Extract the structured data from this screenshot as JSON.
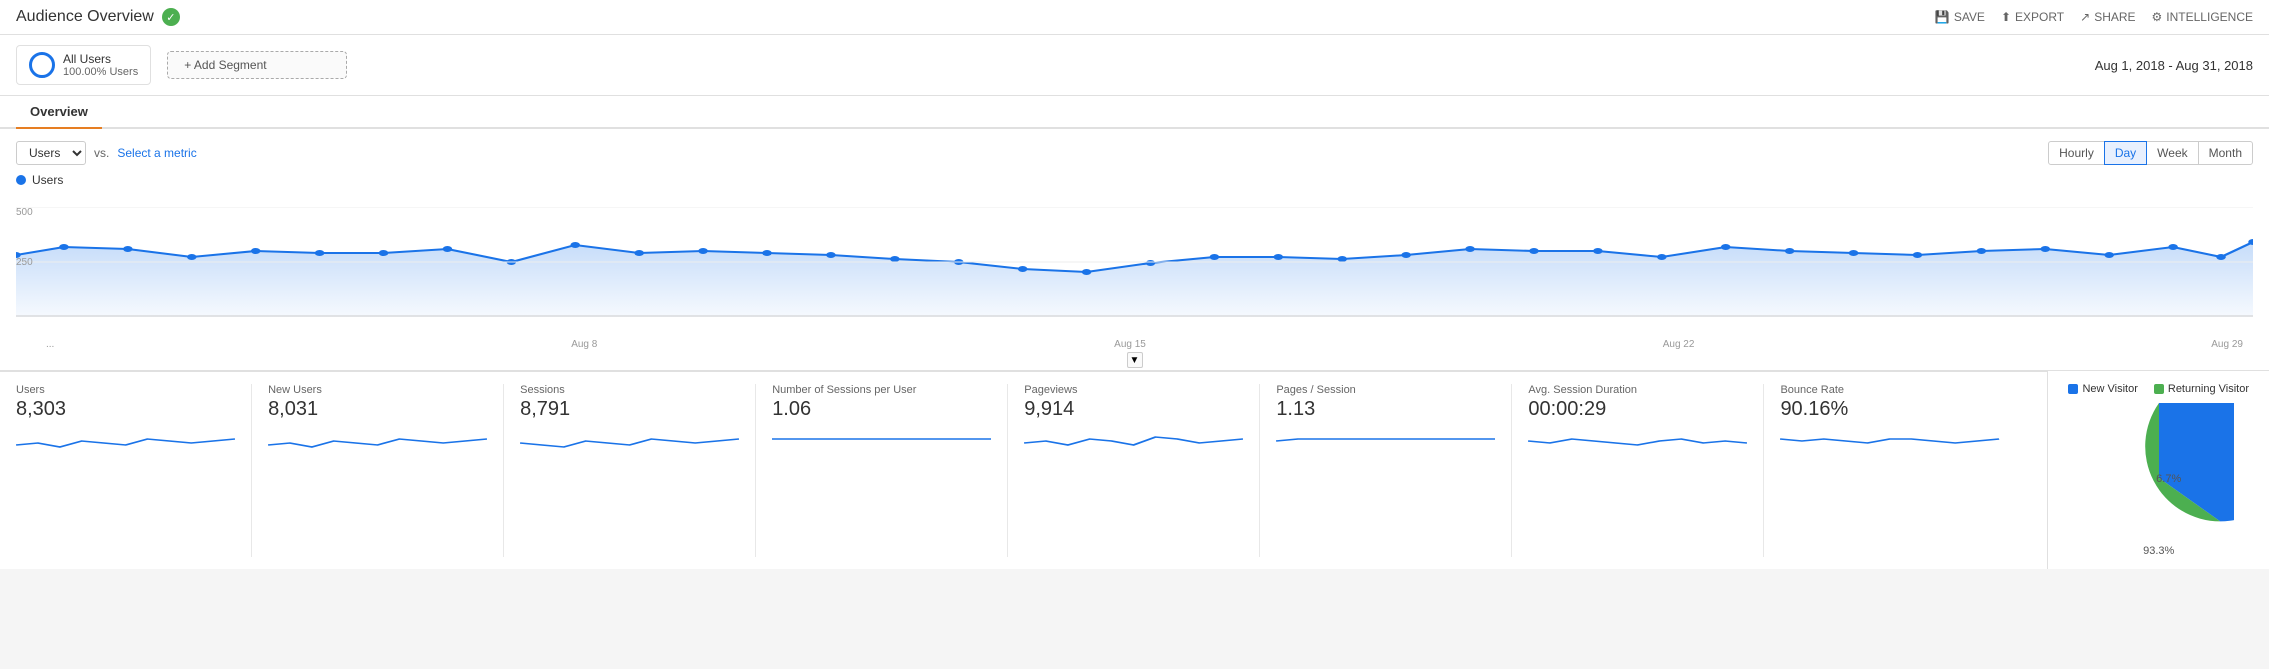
{
  "header": {
    "title": "Audience Overview",
    "actions": [
      {
        "label": "SAVE",
        "icon": "save-icon"
      },
      {
        "label": "EXPORT",
        "icon": "export-icon"
      },
      {
        "label": "SHARE",
        "icon": "share-icon"
      },
      {
        "label": "INTELLIGENCE",
        "icon": "intelligence-icon"
      }
    ]
  },
  "segment": {
    "allUsers": {
      "label": "All Users",
      "sublabel": "100.00% Users"
    },
    "addSegment": "+ Add Segment",
    "dateRange": "Aug 1, 2018 - Aug 31, 2018"
  },
  "tabs": [
    {
      "label": "Overview",
      "active": true
    }
  ],
  "chart": {
    "metricDropdown": "Users",
    "vsLabel": "vs.",
    "selectMetric": "Select a metric",
    "timeButtons": [
      {
        "label": "Hourly",
        "active": false
      },
      {
        "label": "Day",
        "active": true
      },
      {
        "label": "Week",
        "active": false
      },
      {
        "label": "Month",
        "active": false
      }
    ],
    "legendLabel": "Users",
    "yLabels": [
      "500",
      "250"
    ],
    "xLabels": [
      "...",
      "Aug 8",
      "Aug 15",
      "Aug 22",
      "Aug 29"
    ]
  },
  "metrics": [
    {
      "name": "Users",
      "value": "8,303"
    },
    {
      "name": "New Users",
      "value": "8,031"
    },
    {
      "name": "Sessions",
      "value": "8,791"
    },
    {
      "name": "Number of Sessions per User",
      "value": "1.06"
    },
    {
      "name": "Pageviews",
      "value": "9,914"
    },
    {
      "name": "Pages / Session",
      "value": "1.13"
    },
    {
      "name": "Avg. Session Duration",
      "value": "00:00:29"
    },
    {
      "name": "Bounce Rate",
      "value": "90.16%"
    }
  ],
  "pie": {
    "legend": [
      {
        "label": "New Visitor",
        "color": "#1a73e8"
      },
      {
        "label": "Returning Visitor",
        "color": "#4caf50"
      }
    ],
    "slices": [
      {
        "label": "93.3%",
        "color": "#1a73e8",
        "percent": 93.3
      },
      {
        "label": "6.7%",
        "color": "#4caf50",
        "percent": 6.7
      }
    ]
  }
}
